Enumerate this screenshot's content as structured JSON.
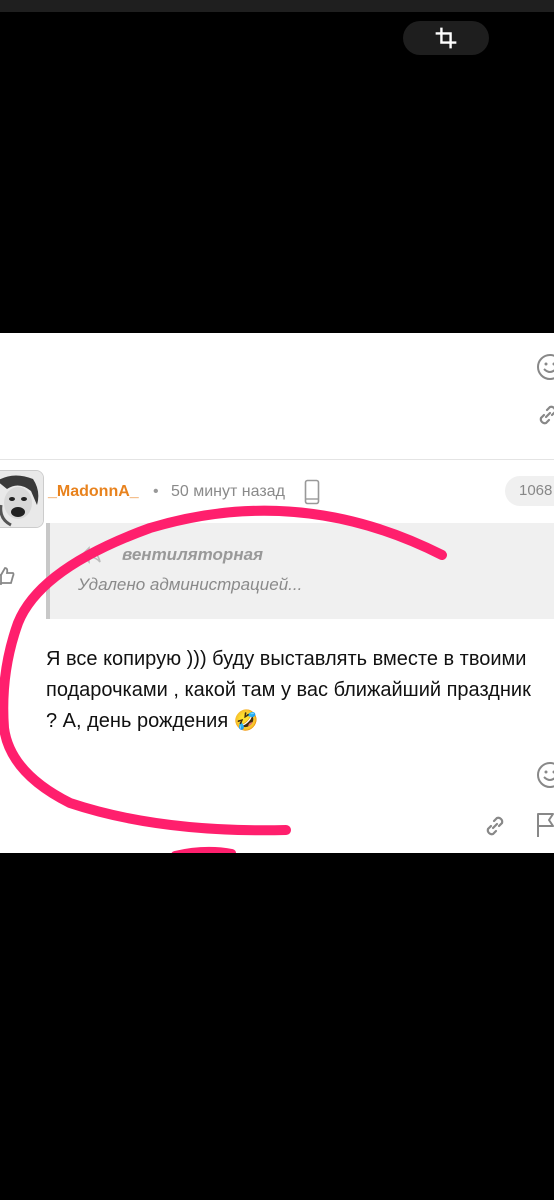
{
  "toolbar": {
    "crop_icon": "crop-icon"
  },
  "comment": {
    "username": "_MadonnA_",
    "separator": "•",
    "time": "50 минут назад",
    "device_icon": "mobile-phone-icon",
    "counter": "1068",
    "quote": {
      "author": "вентиляторная",
      "text": "Удалено администрацией..."
    },
    "text": "Я все копирую ))) буду выставлять вместе в твоими подарочками , какой там у вас ближайший праздник ? А, день рождения",
    "emoji": "🤣"
  },
  "actions": {
    "icons": [
      "smiley-reaction-icon",
      "link-icon",
      "flag-icon"
    ]
  },
  "colors": {
    "background": "#000000",
    "panel": "#ffffff",
    "username": "#e8821d",
    "annotation_stroke": "#ff1f6d",
    "quote_bg": "#f0f0f0"
  }
}
